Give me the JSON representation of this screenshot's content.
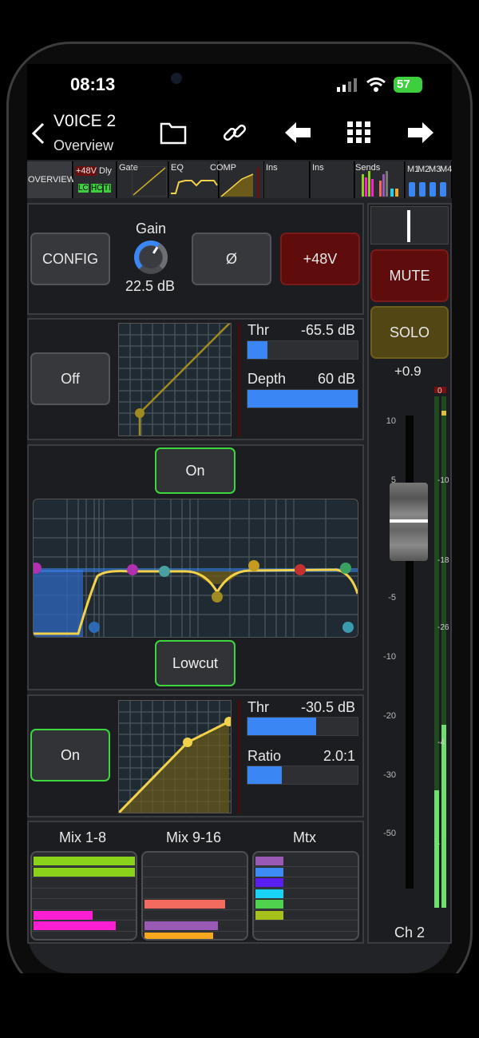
{
  "status": {
    "time": "08:13",
    "battery": "57"
  },
  "nav": {
    "channel_name": "V0ICE 2",
    "subtitle": "Overview"
  },
  "tabs": {
    "overview": "OVERVIEW",
    "preamp": {
      "phantom": "+48V",
      "delay": "Dly",
      "lc": "LC",
      "hc": "HC",
      "ti": "TI"
    },
    "gate": "Gate",
    "eq": "EQ",
    "comp": "COMP",
    "ins1": "Ins",
    "ins2": "Ins",
    "sends": "Sends",
    "mains": [
      "M1",
      "M2",
      "M3",
      "M4"
    ]
  },
  "preamp": {
    "config_label": "CONFIG",
    "gain_label": "Gain",
    "gain_value": "22.5 dB",
    "gain_fraction": 0.62,
    "phase_label": "Ø",
    "phantom_label": "+48V"
  },
  "gate": {
    "state_label": "Off",
    "thr_label": "Thr",
    "thr_value": "-65.5 dB",
    "thr_fraction": 0.18,
    "depth_label": "Depth",
    "depth_value": "60 dB",
    "depth_fraction": 1.0
  },
  "eq": {
    "state_label": "On",
    "lowcut_label": "Lowcut"
  },
  "comp": {
    "state_label": "On",
    "thr_label": "Thr",
    "thr_value": "-30.5 dB",
    "thr_fraction": 0.62,
    "ratio_label": "Ratio",
    "ratio_value": "2.0:1",
    "ratio_fraction": 0.31
  },
  "sends": {
    "mix18_label": "Mix 1-8",
    "mix916_label": "Mix 9-16",
    "mtx_label": "Mtx",
    "mix18_levels": [
      0.98,
      0.98,
      0,
      0,
      0,
      0.57,
      0.79,
      0
    ],
    "mix18_colors": [
      "#8bd21a",
      "#8bd21a",
      "",
      "",
      "",
      "#ff1fd2",
      "#ff1fd2",
      ""
    ],
    "mix916_levels": [
      0,
      0,
      0,
      0,
      0.78,
      0,
      0.71,
      0.66
    ],
    "mix916_colors": [
      "",
      "",
      "",
      "",
      "#f36a5f",
      "",
      "#9b59b6",
      "#f8a81e"
    ],
    "mtx_levels": [
      0.27,
      0.27,
      0.27,
      0.27,
      0.27,
      0.27,
      0,
      0
    ],
    "mtx_colors": [
      "#9b59b6",
      "#3d8cf5",
      "#5a1ef0",
      "#1ad4f5",
      "#4fd34f",
      "#a6c21a",
      "",
      ""
    ]
  },
  "fader": {
    "mute_label": "MUTE",
    "solo_label": "SOLO",
    "value": "+0.9",
    "fader_scale": [
      "10",
      "5",
      "0",
      "-5",
      "-10",
      "-20",
      "-30",
      "-50"
    ],
    "meter_scale": [
      "0",
      "-10",
      "-18",
      "-26",
      "-4",
      "-"
    ],
    "channel_label": "Ch 2"
  },
  "colors": {
    "accent_blue": "#3a86f5",
    "active_green": "#3ed63e",
    "mute_red": "#6b0f0f",
    "solo_gold": "#5e5014",
    "eq_curve": "#f2d24a"
  }
}
